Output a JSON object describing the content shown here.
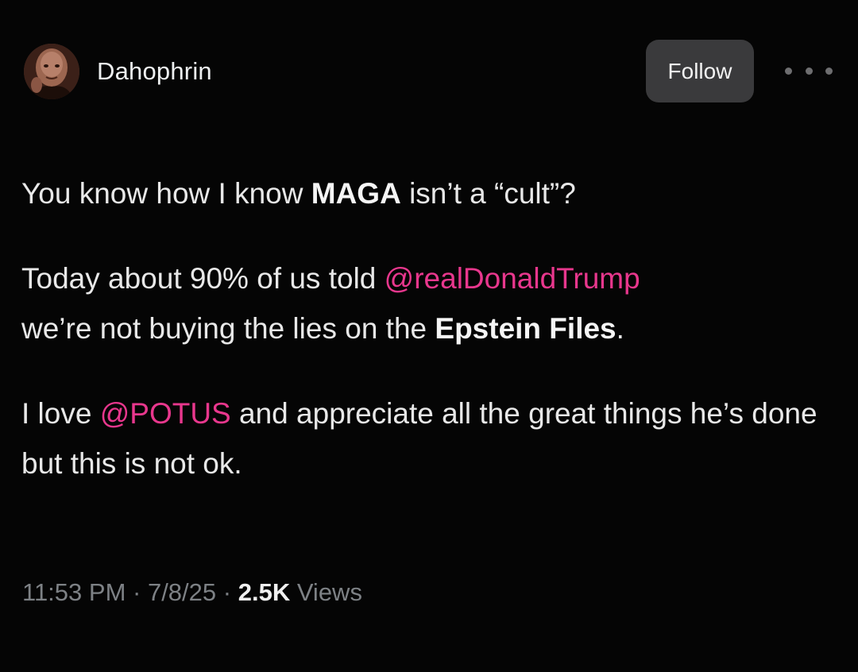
{
  "author": {
    "display_name": "Dahophrin",
    "avatar_icon": "profile-avatar-icon"
  },
  "actions": {
    "follow_label": "Follow",
    "more_icon": "more-options-icon"
  },
  "tweet": {
    "line1": {
      "pre": "You know how I know ",
      "bold": "MAGA",
      "post": " isn’t a “cult”?"
    },
    "line2": {
      "pre": "Today about 90% of us told ",
      "mention": "@realDonaldTrump",
      "mid": " we’re not buying the lies on the ",
      "bold": "Epstein Files",
      "post": "."
    },
    "line3": {
      "pre": "I love ",
      "mention": "@POTUS",
      "post": " and appreciate all the great things he’s done but this is not ok."
    }
  },
  "meta": {
    "time": "11:53 PM",
    "separator": " · ",
    "date": "7/8/25",
    "views_count": "2.5K",
    "views_label": " Views"
  },
  "colors": {
    "background": "#050505",
    "mention": "#e8378d",
    "follow_button": "#3a3a3c",
    "meta_text": "#7d8185"
  }
}
